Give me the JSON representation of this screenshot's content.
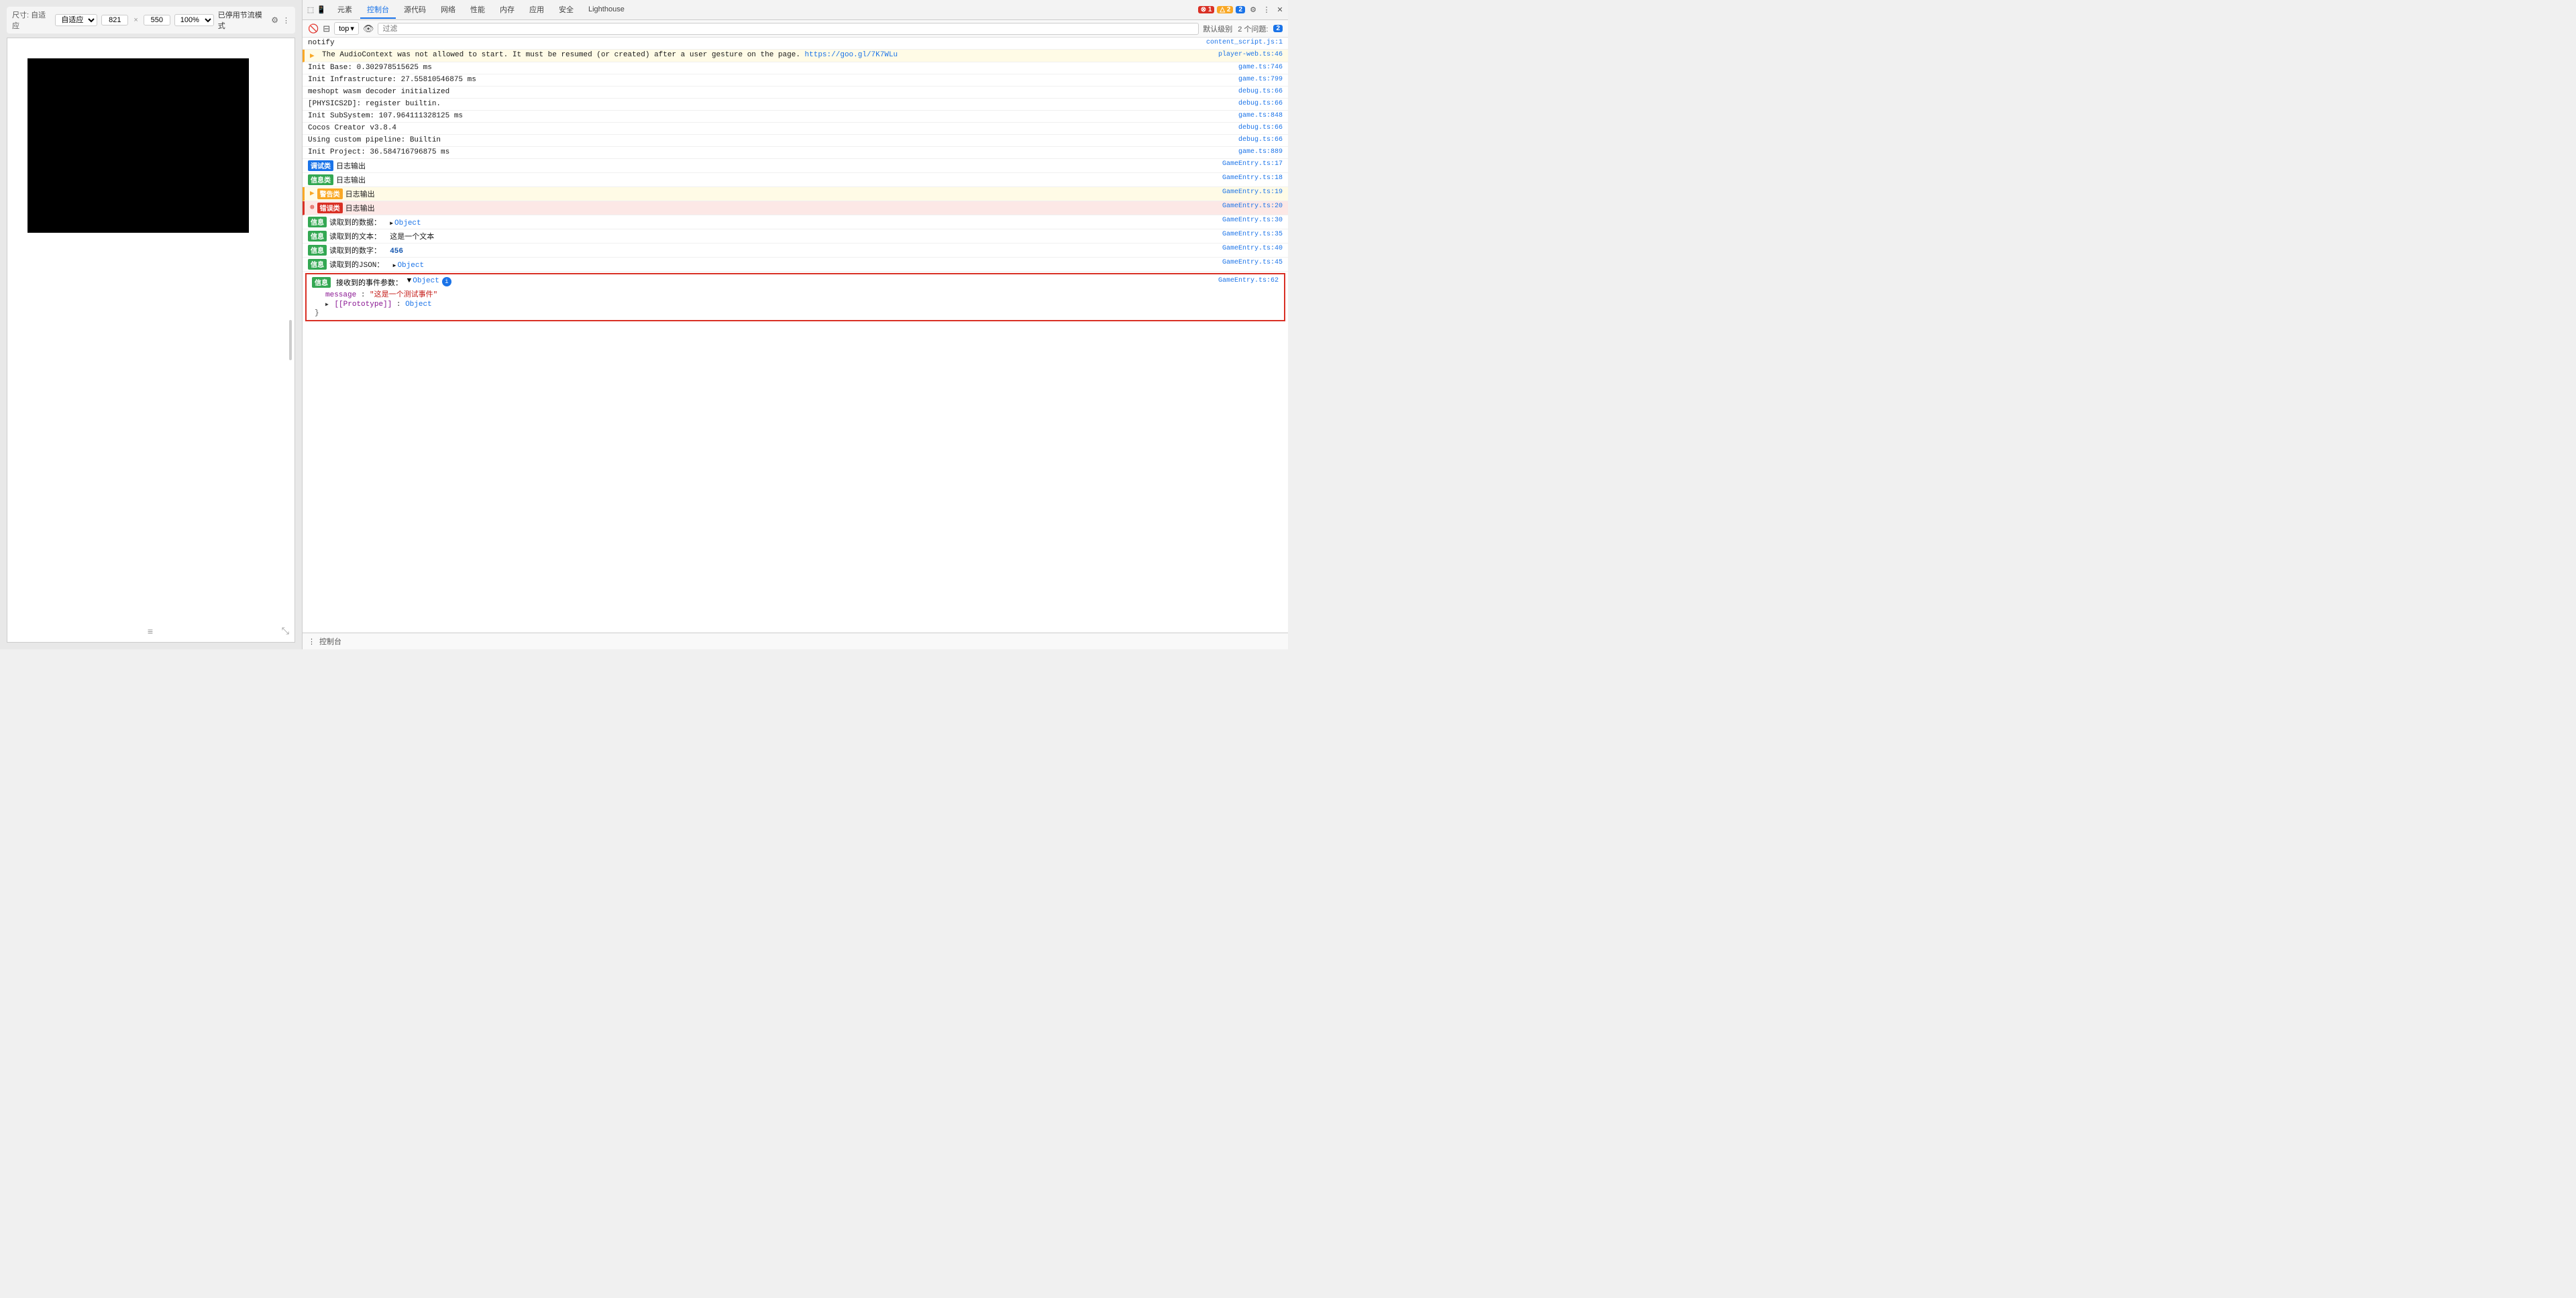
{
  "toolbar": {
    "size_label": "尺寸: 自适应",
    "width": "821",
    "sep": "×",
    "height": "550",
    "zoom": "100%",
    "mode": "已停用节流模式",
    "more_icon": "⋮"
  },
  "devtools": {
    "tabs": [
      {
        "label": "元素",
        "active": false
      },
      {
        "label": "控制台",
        "active": true
      },
      {
        "label": "源代码",
        "active": false
      },
      {
        "label": "网络",
        "active": false
      },
      {
        "label": "性能",
        "active": false
      },
      {
        "label": "内存",
        "active": false
      },
      {
        "label": "应用",
        "active": false
      },
      {
        "label": "安全",
        "active": false
      },
      {
        "label": "Lighthouse",
        "active": false
      }
    ],
    "badges": {
      "errors": "1",
      "warnings": "2",
      "info": "2"
    }
  },
  "console_toolbar": {
    "top_label": "top",
    "filter_placeholder": "过滤",
    "default_level": "默认级别",
    "issues_label": "2 个问题:",
    "issues_count": "2"
  },
  "console_logs": [
    {
      "type": "plain",
      "icon": "",
      "message": "notify",
      "source": "content_script.js:1"
    },
    {
      "type": "warn",
      "icon": "▶",
      "message": "The AudioContext was not allowed to start. It must be resumed (or created) after a user gesture on the page. https://goo.gl/7K7WLu",
      "source": "player-web.ts:46"
    },
    {
      "type": "plain",
      "icon": "",
      "message": "Init Base: 0.302978515625 ms",
      "source": "game.ts:746"
    },
    {
      "type": "plain",
      "icon": "",
      "message": "Init Infrastructure: 27.55810546875 ms",
      "source": "game.ts:799"
    },
    {
      "type": "plain",
      "icon": "",
      "message": "meshopt wasm decoder initialized",
      "source": "debug.ts:66"
    },
    {
      "type": "plain",
      "icon": "",
      "message": "[PHYSICS2D]: register builtin.",
      "source": "debug.ts:66"
    },
    {
      "type": "plain",
      "icon": "",
      "message": "Init SubSystem: 107.964111328125 ms",
      "source": "game.ts:848"
    },
    {
      "type": "plain",
      "icon": "",
      "message": "Cocos Creator v3.8.4",
      "source": "debug.ts:66"
    },
    {
      "type": "plain",
      "icon": "",
      "message": "Using custom pipeline: Builtin",
      "source": "debug.ts:66"
    },
    {
      "type": "plain",
      "icon": "",
      "message": "Init Project: 36.584716796875 ms",
      "source": "game.ts:889"
    },
    {
      "type": "debug",
      "badge": "调试类",
      "badge_type": "debug",
      "message": "日志输出",
      "source": "GameEntry.ts:17"
    },
    {
      "type": "info",
      "badge": "信息类",
      "badge_type": "info",
      "message": "日志输出",
      "source": "GameEntry.ts:18"
    },
    {
      "type": "warn",
      "badge": "警告类",
      "badge_type": "warn",
      "message": "日志输出",
      "source": "GameEntry.ts:19",
      "triangle": true
    },
    {
      "type": "error",
      "badge": "错误类",
      "badge_type": "error",
      "message": "日志输出",
      "source": "GameEntry.ts:20"
    },
    {
      "type": "info",
      "badge": "信息",
      "badge_type": "info",
      "message": "读取到的数据：  ▶ Object",
      "source": "GameEntry.ts:30"
    },
    {
      "type": "info",
      "badge": "信息",
      "badge_type": "info",
      "message": "读取到的文本：  这是一个文本",
      "source": "GameEntry.ts:35"
    },
    {
      "type": "info",
      "badge": "信息",
      "badge_type": "info",
      "message": "读取到的数字：  456",
      "number": "456",
      "source": "GameEntry.ts:40"
    },
    {
      "type": "info",
      "badge": "信息",
      "badge_type": "info",
      "message": "读取到的JSON：  ▶ Object",
      "source": "GameEntry.ts:45"
    },
    {
      "type": "info_expand",
      "badge": "信息",
      "badge_type": "info",
      "message": "接收到的事件参数：",
      "source": "GameEntry.ts:62",
      "expand_content": {
        "root": "▼ Object",
        "info_icon": "ℹ",
        "entries": [
          {
            "key": "message",
            "value": "\"这是一个测试事件\""
          },
          {
            "key": "▶ [[Prototype]]",
            "value": "Object"
          }
        ]
      }
    }
  ],
  "bottom_bar": {
    "label": "控制台"
  }
}
